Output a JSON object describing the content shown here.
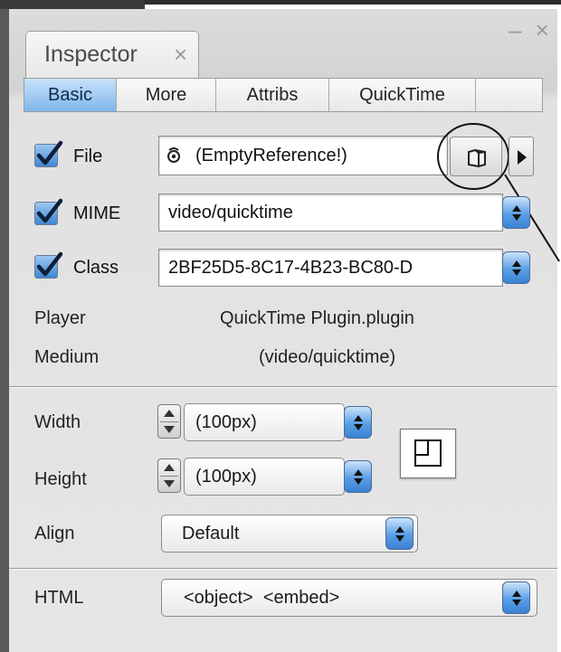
{
  "window": {
    "tab_label": "Inspector",
    "tab_close_glyph": "×",
    "controls_glyph": "– ×"
  },
  "subtabs": [
    {
      "label": "Basic",
      "active": true
    },
    {
      "label": "More",
      "active": false
    },
    {
      "label": "Attribs",
      "active": false
    },
    {
      "label": "QuickTime",
      "active": false
    },
    {
      "label": "",
      "active": false
    }
  ],
  "file": {
    "label": "File",
    "checked": true,
    "value": "(EmptyReference!)",
    "icon": "reference-icon",
    "browse_icon": "folder-icon",
    "menu_icon": "triangle-right-icon"
  },
  "mime": {
    "label": "MIME",
    "checked": true,
    "value": "video/quicktime"
  },
  "class": {
    "label": "Class",
    "checked": true,
    "value": "2BF25D5-8C17-4B23-BC80-D"
  },
  "info": {
    "player_label": "Player",
    "player_value": "QuickTime Plugin.plugin",
    "medium_label": "Medium",
    "medium_value": "(video/quicktime)"
  },
  "size": {
    "width_label": "Width",
    "width_value": "(100px)",
    "height_label": "Height",
    "height_value": "(100px)",
    "resize_icon": "resize-box-icon"
  },
  "align": {
    "label": "Align",
    "value": "Default"
  },
  "html": {
    "label": "HTML",
    "value": "<object>  <embed>"
  },
  "colors": {
    "accent_blue": "#5a9ee5",
    "active_tab": "#9cc9f2",
    "panel_bg": "#e3e3e3"
  }
}
